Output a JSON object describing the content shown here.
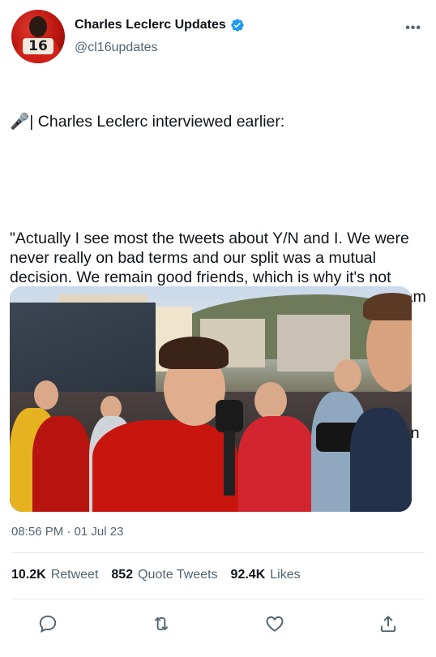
{
  "author": {
    "display_name": "Charles Leclerc Updates",
    "handle": "@cl16updates",
    "avatar_number": "16",
    "verified": true
  },
  "menu": {
    "more_label": "•••"
  },
  "tweet": {
    "paragraphs": [
      "🎤| Charles Leclerc interviewed earlier:",
      "\"Actually I see most the tweets about Y/N and I. We were never really on bad terms and our split was a mutual decision. We remain good friends, which is why it's not surprising why she watches the race and supports the team or we go out with mutual friends.\"",
      "\"She remains one of the best people I know — sunshine in human form. Wouldn't be here without her.\""
    ],
    "media_alt": "photo"
  },
  "meta": {
    "time": "08:56 PM · 01 Jul 23"
  },
  "stats": {
    "retweets": {
      "count": "10.2K",
      "label": "Retweet"
    },
    "quotes": {
      "count": "852",
      "label": "Quote Tweets"
    },
    "likes": {
      "count": "92.4K",
      "label": "Likes"
    }
  },
  "colors": {
    "text": "#0f1419",
    "secondary": "#536471",
    "verified": "#1d9bf0",
    "divider": "#e3e8eb",
    "ferrari_red": "#d01f17"
  },
  "icons": {
    "reply": "reply-icon",
    "retweet": "retweet-icon",
    "like": "like-icon",
    "share": "share-icon"
  }
}
